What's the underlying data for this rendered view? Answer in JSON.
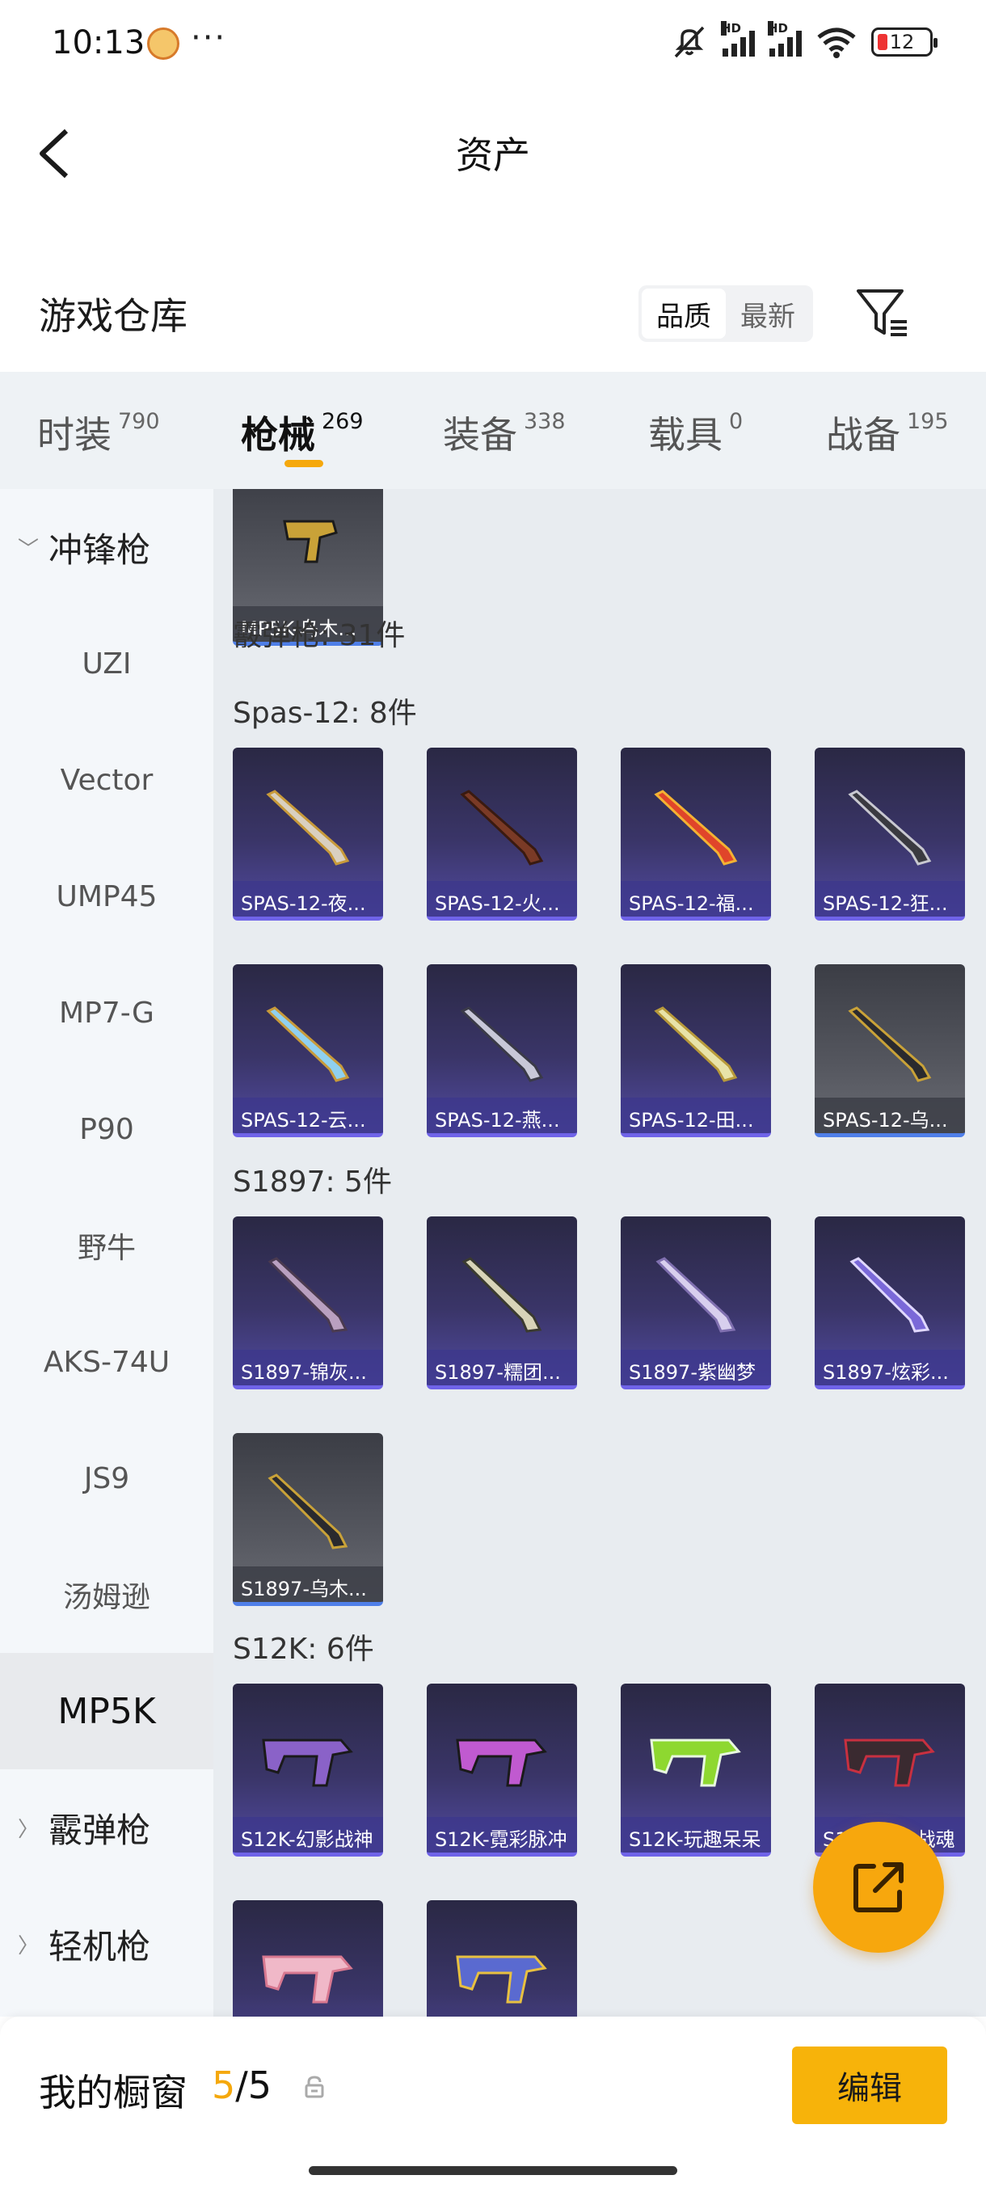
{
  "status_bar": {
    "time": "10:13",
    "more": "···",
    "hd1": "HD",
    "hd2": "HD",
    "battery": "12"
  },
  "header": {
    "title": "资产"
  },
  "section": {
    "title": "游戏仓库",
    "sort_options": [
      "品质",
      "最新"
    ],
    "active_sort": 0
  },
  "tabs": [
    {
      "label": "时装",
      "count": "790"
    },
    {
      "label": "枪械",
      "count": "269"
    },
    {
      "label": "装备",
      "count": "338"
    },
    {
      "label": "载具",
      "count": "0"
    },
    {
      "label": "战备",
      "count": "195"
    }
  ],
  "active_tab": 1,
  "sidebar": {
    "groups": [
      {
        "label": "冲锋枪",
        "expanded": true
      },
      {
        "label": "霰弹枪",
        "expanded": false
      },
      {
        "label": "轻机枪",
        "expanded": false
      }
    ],
    "items": [
      "UZI",
      "Vector",
      "UMP45",
      "MP7-G",
      "P90",
      "野牛",
      "AKS-74U",
      "JS9",
      "汤姆逊",
      "MP5K"
    ],
    "active_item": "MP5K"
  },
  "content": {
    "top_card": {
      "name": "MP5K-乌木...",
      "color": "gray"
    },
    "category_label": "霰弹枪: 31件",
    "groups": [
      {
        "label": "Spas-12: 8件",
        "items": [
          {
            "name": "SPAS-12-夜...",
            "color": "purple"
          },
          {
            "name": "SPAS-12-火...",
            "color": "purple"
          },
          {
            "name": "SPAS-12-福...",
            "color": "purple"
          },
          {
            "name": "SPAS-12-狂...",
            "color": "purple"
          },
          {
            "name": "SPAS-12-云...",
            "color": "purple"
          },
          {
            "name": "SPAS-12-燕...",
            "color": "purple"
          },
          {
            "name": "SPAS-12-田...",
            "color": "purple"
          },
          {
            "name": "SPAS-12-乌...",
            "color": "gray"
          }
        ]
      },
      {
        "label": "S1897: 5件",
        "items": [
          {
            "name": "S1897-锦灰...",
            "color": "purple"
          },
          {
            "name": "S1897-糯团...",
            "color": "purple"
          },
          {
            "name": "S1897-紫幽梦",
            "color": "purple"
          },
          {
            "name": "S1897-炫彩...",
            "color": "purple"
          },
          {
            "name": "S1897-乌木...",
            "color": "gray"
          }
        ]
      },
      {
        "label": "S12K: 6件",
        "items": [
          {
            "name": "S12K-幻影战神",
            "color": "purple"
          },
          {
            "name": "S12K-霓彩脉冲",
            "color": "purple"
          },
          {
            "name": "S12K-玩趣呆呆",
            "color": "purple"
          },
          {
            "name": "S12K-嗜血战魂",
            "color": "purple"
          },
          {
            "name": "",
            "color": "purple"
          },
          {
            "name": "",
            "color": "purple"
          }
        ]
      }
    ]
  },
  "bottom_bar": {
    "label": "我的橱窗",
    "current": "5",
    "total": "/5",
    "edit_label": "编辑"
  },
  "colors": {
    "accent": "#f7b30a",
    "tab_underline": "#f5a80c",
    "sidebar_bg": "#f4f7fa",
    "content_bg": "#e8ecf0"
  }
}
